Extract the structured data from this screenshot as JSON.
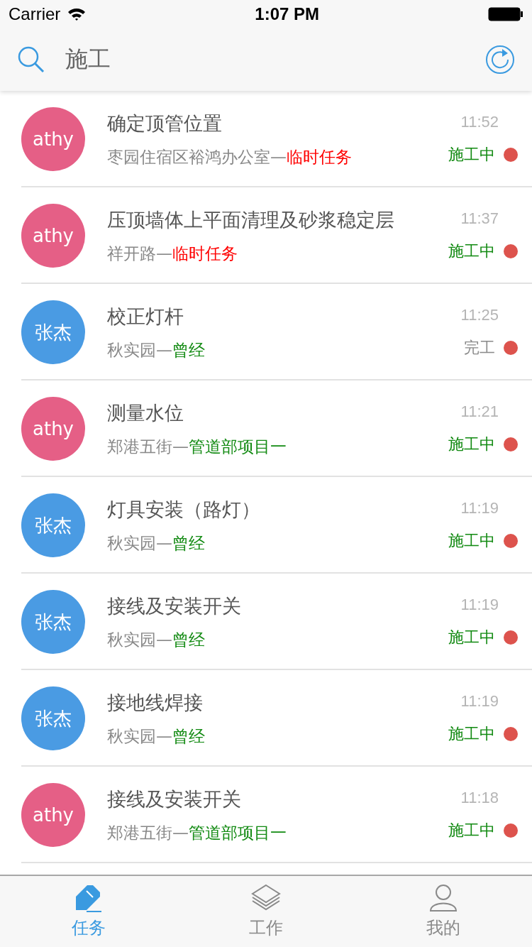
{
  "status_bar": {
    "carrier": "Carrier",
    "time": "1:07 PM"
  },
  "search": {
    "value": "施工"
  },
  "tasks": [
    {
      "avatar": {
        "text": "athy",
        "color": "#e55f86"
      },
      "title": "确定顶管位置",
      "time": "11:52",
      "location": "枣园住宿区裕鸿办公室—",
      "tag": {
        "text": "临时任务",
        "color": "#ff0000"
      },
      "status": {
        "text": "施工中",
        "color": "#128a12"
      },
      "dot": {
        "color": "#dd534d"
      }
    },
    {
      "avatar": {
        "text": "athy",
        "color": "#e55f86"
      },
      "title": "压顶墙体上平面清理及砂浆稳定层",
      "time": "11:37",
      "location": "祥开路—",
      "tag": {
        "text": "临时任务",
        "color": "#ff0000"
      },
      "status": {
        "text": "施工中",
        "color": "#128a12"
      },
      "dot": {
        "color": "#dd534d"
      }
    },
    {
      "avatar": {
        "text": "张杰",
        "color": "#4a9be3"
      },
      "title": "校正灯杆",
      "time": "11:25",
      "location": "秋实园—",
      "tag": {
        "text": "曾经",
        "color": "#128a12"
      },
      "status": {
        "text": "完工",
        "color": "#8a8a8a"
      },
      "dot": {
        "color": "#dd534d"
      }
    },
    {
      "avatar": {
        "text": "athy",
        "color": "#e55f86"
      },
      "title": "测量水位",
      "time": "11:21",
      "location": "郑港五街—",
      "tag": {
        "text": "管道部项目一",
        "color": "#128a12"
      },
      "status": {
        "text": "施工中",
        "color": "#128a12"
      },
      "dot": {
        "color": "#dd534d"
      }
    },
    {
      "avatar": {
        "text": "张杰",
        "color": "#4a9be3"
      },
      "title": "灯具安装（路灯）",
      "time": "11:19",
      "location": "秋实园—",
      "tag": {
        "text": "曾经",
        "color": "#128a12"
      },
      "status": {
        "text": "施工中",
        "color": "#128a12"
      },
      "dot": {
        "color": "#dd534d"
      }
    },
    {
      "avatar": {
        "text": "张杰",
        "color": "#4a9be3"
      },
      "title": "接线及安装开关",
      "time": "11:19",
      "location": "秋实园—",
      "tag": {
        "text": "曾经",
        "color": "#128a12"
      },
      "status": {
        "text": "施工中",
        "color": "#128a12"
      },
      "dot": {
        "color": "#dd534d"
      }
    },
    {
      "avatar": {
        "text": "张杰",
        "color": "#4a9be3"
      },
      "title": "接地线焊接",
      "time": "11:19",
      "location": "秋实园—",
      "tag": {
        "text": "曾经",
        "color": "#128a12"
      },
      "status": {
        "text": "施工中",
        "color": "#128a12"
      },
      "dot": {
        "color": "#dd534d"
      }
    },
    {
      "avatar": {
        "text": "athy",
        "color": "#e55f86"
      },
      "title": "接线及安装开关",
      "time": "11:18",
      "location": "郑港五街—",
      "tag": {
        "text": "管道部项目一",
        "color": "#128a12"
      },
      "status": {
        "text": "施工中",
        "color": "#128a12"
      },
      "dot": {
        "color": "#dd534d"
      }
    }
  ],
  "tab_bar": [
    {
      "kind": "task",
      "label": "任务",
      "selected": true
    },
    {
      "kind": "work",
      "label": "工作",
      "selected": false
    },
    {
      "kind": "me",
      "label": "我的",
      "selected": false
    }
  ]
}
